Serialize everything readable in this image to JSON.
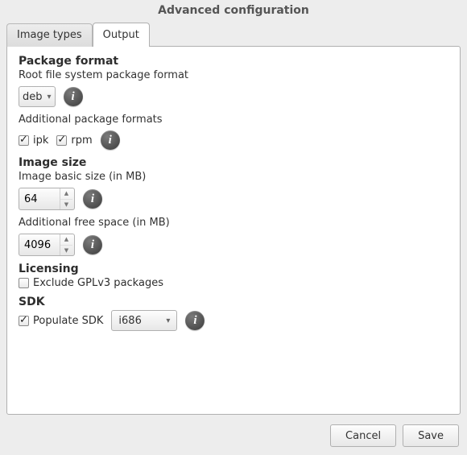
{
  "title": "Advanced configuration",
  "tabs": {
    "image_types": "Image types",
    "output": "Output"
  },
  "package_format": {
    "title": "Package format",
    "root_label": "Root file system package format",
    "root_value": "deb",
    "additional_label": "Additional package formats",
    "ipk_label": "ipk",
    "ipk_checked": true,
    "rpm_label": "rpm",
    "rpm_checked": true
  },
  "image_size": {
    "title": "Image size",
    "basic_label": "Image basic size (in MB)",
    "basic_value": "64",
    "addl_label": "Additional free space (in MB)",
    "addl_value": "4096"
  },
  "licensing": {
    "title": "Licensing",
    "exclude_label": "Exclude GPLv3 packages",
    "exclude_checked": false
  },
  "sdk": {
    "title": "SDK",
    "populate_label": "Populate SDK",
    "populate_checked": true,
    "arch_value": "i686"
  },
  "buttons": {
    "cancel": "Cancel",
    "save": "Save"
  }
}
